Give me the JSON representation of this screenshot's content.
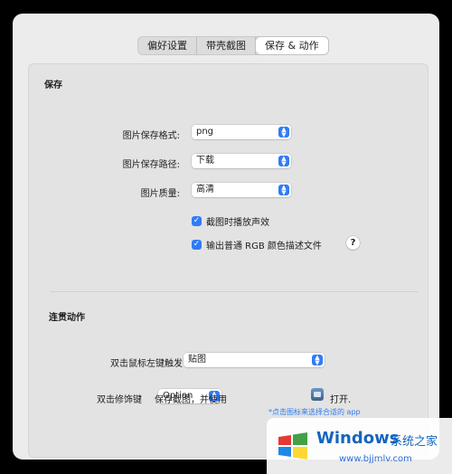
{
  "tabs": [
    {
      "label": "偏好设置"
    },
    {
      "label": "带壳截图"
    },
    {
      "label": "保存 & 动作"
    }
  ],
  "save": {
    "title": "保存",
    "format_label": "图片保存格式:",
    "format_value": "png",
    "path_label": "图片保存路径:",
    "path_value": "下载",
    "quality_label": "图片质量:",
    "quality_value": "高清",
    "check_sound": "截图时播放声效",
    "check_rgb": "输出普通 RGB 颜色描述文件",
    "help": "?"
  },
  "actions": {
    "title": "连贯动作",
    "dblclick_label": "双击鼠标左键触发",
    "dblclick_value": "贴图",
    "modifier_label": "双击修饰键",
    "modifier_value": "Option",
    "save_text": "保存截图，并使用",
    "open_text": "打开.",
    "note": "*点击图标来选择合适的 app"
  },
  "watermark": {
    "title": "Windows",
    "cn": "系统之家",
    "url": "www.bjjmlv.com"
  },
  "colors": {
    "accent": "#2f7cf6",
    "window_bg": "#ececec"
  }
}
